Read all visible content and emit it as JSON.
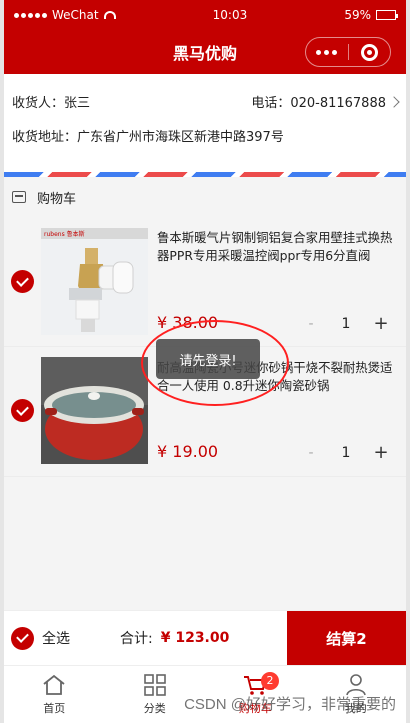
{
  "status": {
    "carrier": "WeChat",
    "time": "10:03",
    "battery": "59%"
  },
  "nav": {
    "title": "黑马优购"
  },
  "address": {
    "receiver": "收货人：张三",
    "phone": "电话：020-81167888",
    "detail": "收货地址：广东省广州市海珠区新港中路397号"
  },
  "cart": {
    "header": "购物车",
    "items": [
      {
        "image_label": "rubens 鲁本斯",
        "title": "鲁本斯暖气片钢制铜铝复合家用壁挂式换热器PPR专用采暖温控阀ppr专用6分直阀",
        "price": "¥ 38.00",
        "qty": "1",
        "minus": "-",
        "plus": "+"
      },
      {
        "title": "耐高温陶瓷小号迷你砂锅干烧不裂耐热煲适合一人使用 0.8升迷你陶瓷砂锅",
        "price": "¥ 19.00",
        "qty": "1",
        "minus": "-",
        "plus": "+"
      }
    ]
  },
  "toast": {
    "text": "请先登录!"
  },
  "checkout": {
    "select_all": "全选",
    "total_label": "合计:",
    "total_value": "¥ 123.00",
    "button_label": "结算2"
  },
  "tabbar": {
    "items": [
      {
        "label": "首页",
        "icon": "home-icon"
      },
      {
        "label": "分类",
        "icon": "grid-icon"
      },
      {
        "label": "购物车",
        "icon": "cart-icon",
        "badge": "2"
      },
      {
        "label": "我的",
        "icon": "user-icon"
      }
    ]
  },
  "watermark": "CSDN @好好学习，非常重要的",
  "colors": {
    "brand": "#c40000",
    "badge": "#ff3b30",
    "annotation": "#ff2020"
  }
}
